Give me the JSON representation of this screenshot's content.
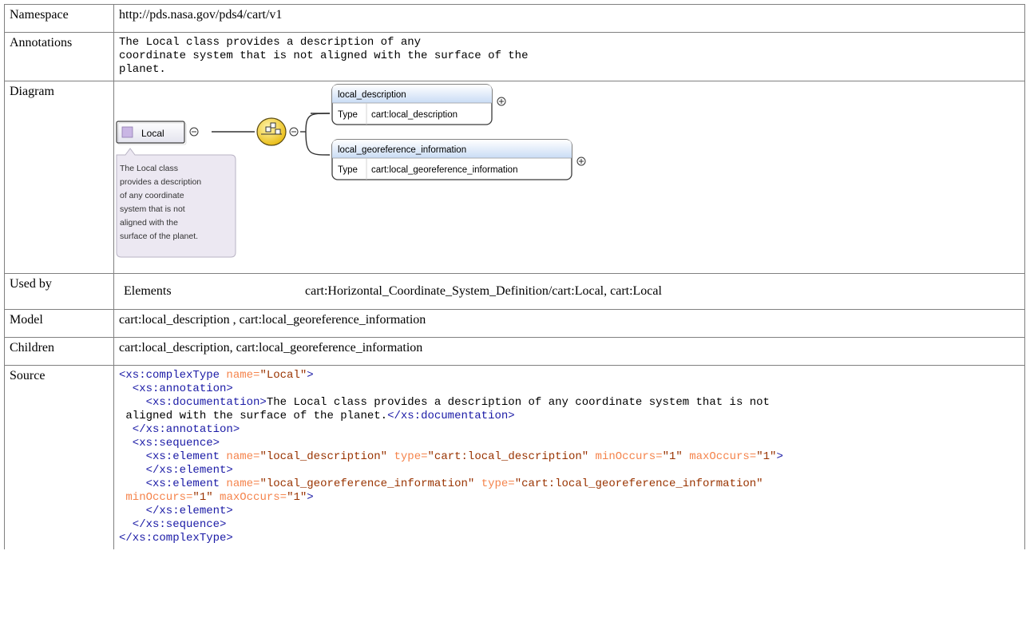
{
  "rows": {
    "namespace": {
      "label": "Namespace",
      "value": "http://pds.nasa.gov/pds4/cart/v1"
    },
    "annotations": {
      "label": "Annotations",
      "lines": [
        "The Local class provides a description of any",
        "coordinate system that is not aligned with the surface of the",
        "planet."
      ]
    },
    "diagram": {
      "label": "Diagram",
      "root_name": "Local",
      "note_lines": [
        "The Local class",
        "provides a description",
        "of any coordinate",
        "system that is not",
        "aligned with the",
        "surface of the planet."
      ],
      "elements": [
        {
          "name": "local_description",
          "type_label": "Type",
          "type_value": "cart:local_description"
        },
        {
          "name": "local_georeference_information",
          "type_label": "Type",
          "type_value": "cart:local_georeference_information"
        }
      ],
      "colors": {
        "box_border": "#3b3b3b",
        "header_top": "#ffffff",
        "header_bottom": "#c9dcf5",
        "note_bg": "#ece8f2",
        "compositor": "#f4d23a"
      }
    },
    "used_by": {
      "label": "Used by",
      "type": "Elements",
      "value": "cart:Horizontal_Coordinate_System_Definition/cart:Local, cart:Local"
    },
    "model": {
      "label": "Model",
      "value": "cart:local_description , cart:local_georeference_information"
    },
    "children": {
      "label": "Children",
      "value": "cart:local_description, cart:local_georeference_information"
    },
    "source": {
      "label": "Source",
      "l1_open": "<xs:complexType",
      "l1_attr": " name=",
      "l1_val": "\"Local\"",
      "l1_close": ">",
      "l2": "  <xs:annotation>",
      "l3_open": "    <xs:documentation>",
      "l3_text": "The Local class provides a description of any coordinate system that is not",
      "l4_text": " aligned with the surface of the planet.",
      "l4_close": "</xs:documentation>",
      "l5": "  </xs:annotation>",
      "l6": "  <xs:sequence>",
      "l7_open": "    <xs:element",
      "l7_a1": " name=",
      "l7_v1": "\"local_description\"",
      "l7_a2": " type=",
      "l7_v2": "\"cart:local_description\"",
      "l7_a3": " minOccurs=",
      "l7_v3": "\"1\"",
      "l7_a4": " maxOccurs=",
      "l7_v4": "\"1\"",
      "l7_close": ">",
      "l8": "    </xs:element>",
      "l9_open": "    <xs:element",
      "l9_a1": " name=",
      "l9_v1": "\"local_georeference_information\"",
      "l9_a2": " type=",
      "l9_v2": "\"cart:local_georeference_information\"",
      "l10_a1": " minOccurs=",
      "l10_v1": "\"1\"",
      "l10_a2": " maxOccurs=",
      "l10_v2": "\"1\"",
      "l10_close": ">",
      "l11": "    </xs:element>",
      "l12": "  </xs:sequence>",
      "l13": "</xs:complexType>"
    }
  }
}
